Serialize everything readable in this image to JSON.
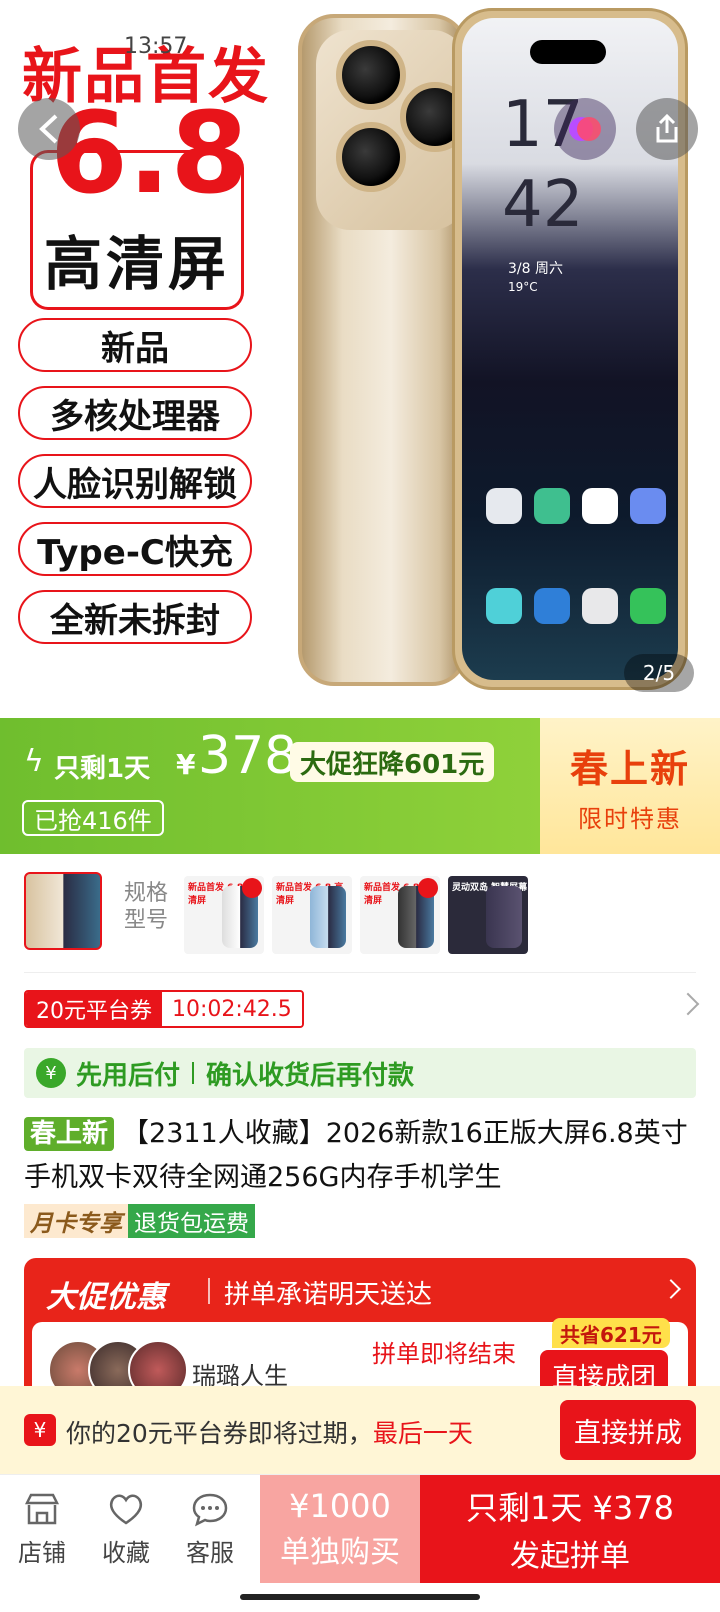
{
  "status_bar": {
    "time": "13:57"
  },
  "hero": {
    "headline": "新品首发",
    "screen_size": "6.8",
    "screen_label": "高清屏",
    "features": [
      "新品",
      "多核处理器",
      "人脸识别解锁",
      "Type-C快充",
      "全新未拆封"
    ],
    "image_counter": "2/5",
    "phone_screen": {
      "time_hour": "17",
      "time_min": "42",
      "date": "3/8 周六",
      "weather": "19°C"
    }
  },
  "price_banner": {
    "remain_text": "只剩1天",
    "currency": "¥",
    "price": "378",
    "promo": "大促狂降601元",
    "sold": "已抢416件",
    "new_title": "春上新",
    "new_sub": "限时特惠",
    "colors": {
      "green": "#6fbe2e",
      "orange": "#e8400c"
    }
  },
  "spec": {
    "label": "规格型号",
    "thumb_texts": [
      "新品首发 6.8 高清屏",
      "新品首发 6.8 高清屏",
      "新品首发 6.8 高清屏",
      "灵动双岛 智慧屏幕"
    ]
  },
  "coupon": {
    "label": "20元平台券",
    "countdown": "10:02:42.5"
  },
  "pay_later": {
    "title": "先用后付",
    "desc": "确认收货后再付款"
  },
  "product": {
    "badge": "春上新",
    "title": "【2311人收藏】2026新款16正版大屏6.8英寸手机双卡双待全网通256G内存手机学生",
    "tag_month": "月卡专享",
    "tag_return": "退货包运费"
  },
  "promo_card": {
    "title": "大促优惠",
    "subtitle": "拼单承诺明天送达",
    "user": "瑞璐人生",
    "ending": "拼单即将结束",
    "join": "直接成团",
    "save": "共省621元"
  },
  "expire_bar": {
    "text": "你的20元平台券即将过期，",
    "last": "最后一天",
    "button": "直接拼成"
  },
  "bottom_bar": {
    "store": "店铺",
    "favorite": "收藏",
    "service": "客服",
    "alone_price": "¥1000",
    "alone_label": "单独购买",
    "group_price": "只剩1天 ¥378",
    "group_label": "发起拼单"
  }
}
